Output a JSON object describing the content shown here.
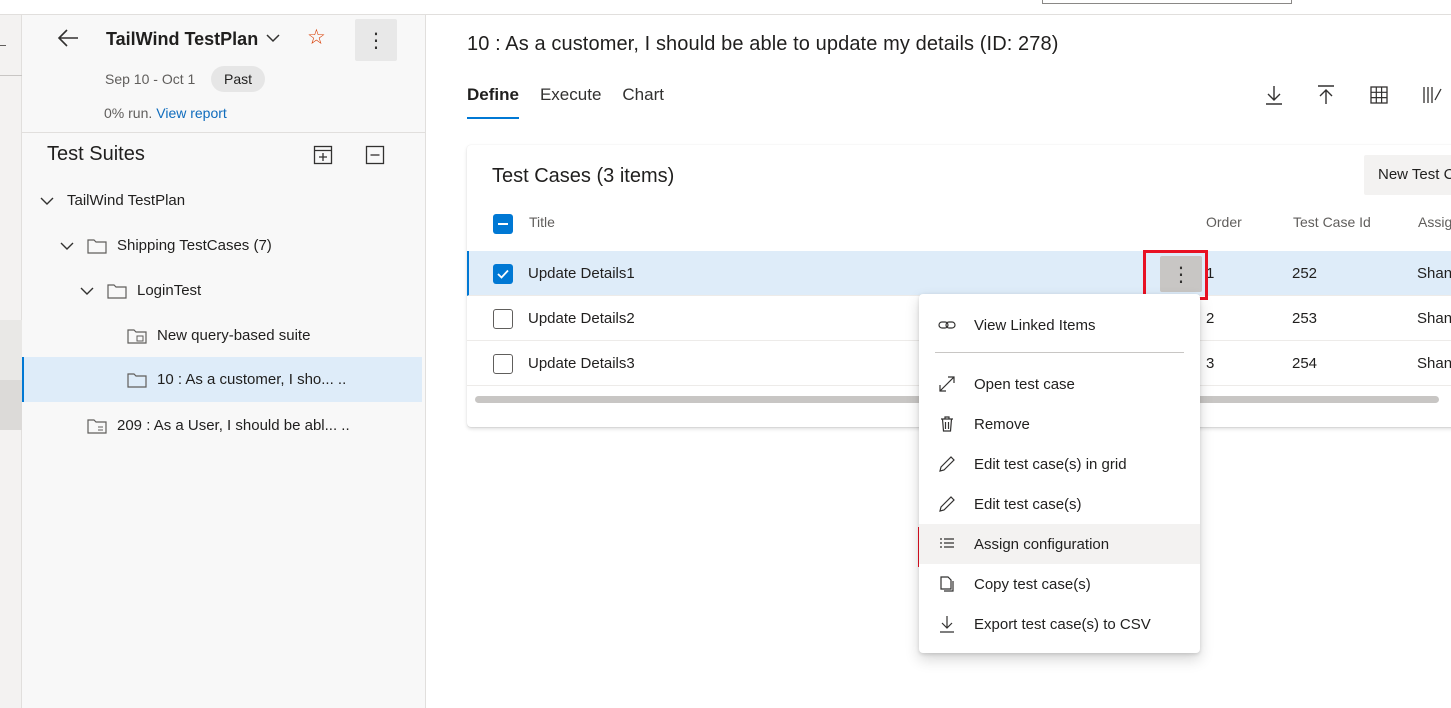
{
  "plan": {
    "title": "TailWind TestPlan",
    "dates": "Sep 10 - Oct 1",
    "status_badge": "Past",
    "run_text": "0% run.",
    "report_link": "View report"
  },
  "suites": {
    "title": "Test Suites",
    "tree": [
      {
        "label": "TailWind TestPlan",
        "expanded": true,
        "icon": "chevron-down-icon"
      },
      {
        "label": "Shipping TestCases (7)",
        "expanded": true,
        "icon": "folder-icon"
      },
      {
        "label": "LoginTest",
        "expanded": true,
        "icon": "folder-icon"
      },
      {
        "label": "New query-based suite",
        "icon": "query-suite-icon"
      },
      {
        "label": "10 : As a customer, I sho...   ..",
        "selected": true,
        "icon": "folder-icon"
      },
      {
        "label": "209 : As a User, I should be abl...  ..",
        "icon": "requirement-suite-icon"
      }
    ]
  },
  "main": {
    "title": "10 : As a customer, I should be able to update my details (ID: 278)",
    "tabs": [
      {
        "label": "Define",
        "active": true
      },
      {
        "label": "Execute"
      },
      {
        "label": "Chart"
      }
    ],
    "toolbar_icons": [
      "download-icon",
      "upload-icon",
      "grid-icon",
      "column-options-icon"
    ]
  },
  "testcases": {
    "title": "Test Cases (3 items)",
    "new_button": "New Test C",
    "columns": {
      "title": "Title",
      "order": "Order",
      "id": "Test Case Id",
      "assigned": "Assig"
    },
    "rows": [
      {
        "title": "Update Details1",
        "order": "1",
        "id": "252",
        "assigned": "Shan",
        "checked": true
      },
      {
        "title": "Update Details2",
        "order": "2",
        "id": "253",
        "assigned": "Shan",
        "checked": false
      },
      {
        "title": "Update Details3",
        "order": "3",
        "id": "254",
        "assigned": "Shan",
        "checked": false
      }
    ]
  },
  "context_menu": {
    "items": [
      {
        "label": "View Linked Items",
        "icon": "link-icon"
      },
      {
        "label": "Open test case",
        "icon": "expand-arrow-icon"
      },
      {
        "label": "Remove",
        "icon": "trash-icon"
      },
      {
        "label": "Edit test case(s) in grid",
        "icon": "pencil-icon"
      },
      {
        "label": "Edit test case(s)",
        "icon": "pencil-icon"
      },
      {
        "label": "Assign configuration",
        "icon": "assign-list-icon",
        "highlighted": true
      },
      {
        "label": "Copy test case(s)",
        "icon": "copy-icon"
      },
      {
        "label": "Export test case(s) to CSV",
        "icon": "download-icon"
      }
    ]
  },
  "colors": {
    "accent": "#0078d4",
    "link": "#0f6cbd",
    "selected_bg": "#deecf9",
    "highlight_red": "#e81123",
    "star": "#d83b01"
  }
}
